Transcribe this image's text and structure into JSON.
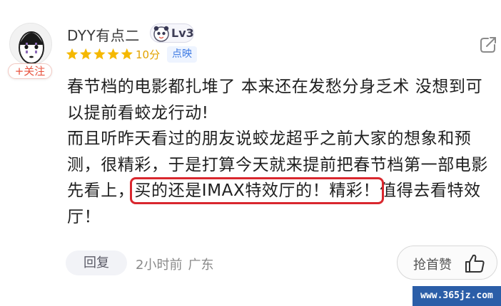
{
  "user": {
    "name": "DYY有点二",
    "level": "Lv3",
    "follow_label": "+关注"
  },
  "rating": {
    "stars_filled": 5,
    "stars_total": 5,
    "score": "10分",
    "source_tag": "点映"
  },
  "comment": {
    "line1": "春节档的电影都扎堆了 本来还在发愁分身乏术 没想到可以提前看蛟龙行动!",
    "line2_before": "而且听昨天看过的朋友说蛟龙超乎之前大家的想象和预测，很精彩，于是打算今天就来提前把春节档第一部电影先看上，",
    "highlight": "买的还是IMAX特效厅的！精彩！",
    "line2_after": "值得去看特效厅！"
  },
  "footer": {
    "reply_label": "回复",
    "time": "2小时前",
    "location": "广东",
    "like_label": "抢首赞"
  },
  "watermark": "www.365jz.com",
  "colors": {
    "star": "#f5b800",
    "score": "#e2a300",
    "follow": "#e8523e",
    "tag_bg": "#eef4ff",
    "tag_text": "#3d7ae3",
    "highlight_border": "#d9272e",
    "watermark_bg": "#2b5ea8"
  },
  "icons": {
    "share": "share-icon",
    "like": "thumbs-up-icon",
    "level": "level-mascot-icon"
  }
}
